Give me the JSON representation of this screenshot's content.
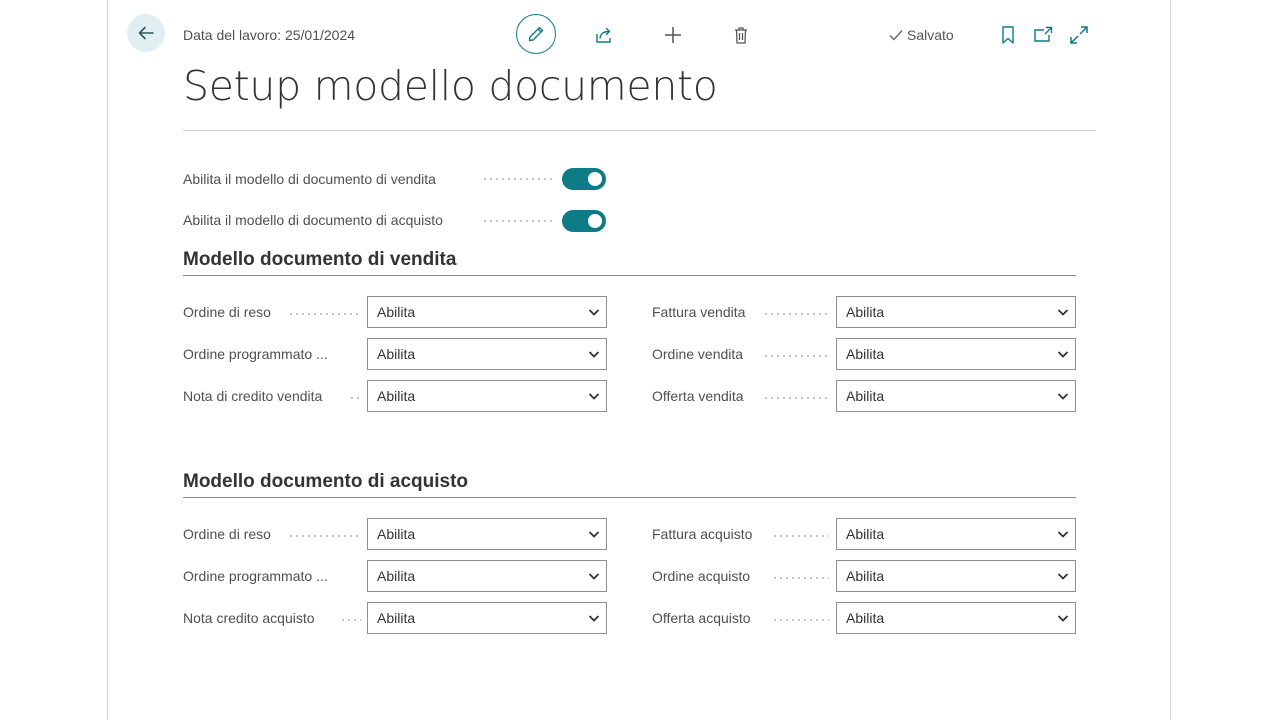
{
  "header": {
    "workdate": "Data del lavoro: 25/01/2024",
    "saved_label": "Salvato"
  },
  "page": {
    "title": "Setup modello documento"
  },
  "toggles": [
    {
      "label": "Abilita il modello di documento di vendita",
      "value": true
    },
    {
      "label": "Abilita il modello di documento di acquisto",
      "value": true
    }
  ],
  "sales": {
    "title": "Modello documento di vendita",
    "left": [
      {
        "label": "Ordine di reso",
        "value": "Abilita"
      },
      {
        "label": "Ordine programmato ...",
        "value": "Abilita"
      },
      {
        "label": "Nota di credito vendita",
        "value": "Abilita"
      }
    ],
    "right": [
      {
        "label": "Fattura vendita",
        "value": "Abilita"
      },
      {
        "label": "Ordine vendita",
        "value": "Abilita"
      },
      {
        "label": "Offerta vendita",
        "value": "Abilita"
      }
    ]
  },
  "purchase": {
    "title": "Modello documento di acquisto",
    "left": [
      {
        "label": "Ordine di reso",
        "value": "Abilita"
      },
      {
        "label": "Ordine programmato ...",
        "value": "Abilita"
      },
      {
        "label": "Nota credito acquisto",
        "value": "Abilita"
      }
    ],
    "right": [
      {
        "label": "Fattura acquisto",
        "value": "Abilita"
      },
      {
        "label": "Ordine acquisto",
        "value": "Abilita"
      },
      {
        "label": "Offerta acquisto",
        "value": "Abilita"
      }
    ]
  },
  "icons": {
    "back": "arrow-left-icon",
    "edit": "pencil-icon",
    "share": "share-icon",
    "new": "plus-icon",
    "delete": "trash-icon",
    "saved": "checkmark-icon",
    "bookmark": "bookmark-icon",
    "open_new": "open-new-window-icon",
    "expand": "expand-icon",
    "dropdown": "chevron-down-icon"
  },
  "colors": {
    "accent": "#0e7c86",
    "back_bg": "#e1eff2"
  }
}
